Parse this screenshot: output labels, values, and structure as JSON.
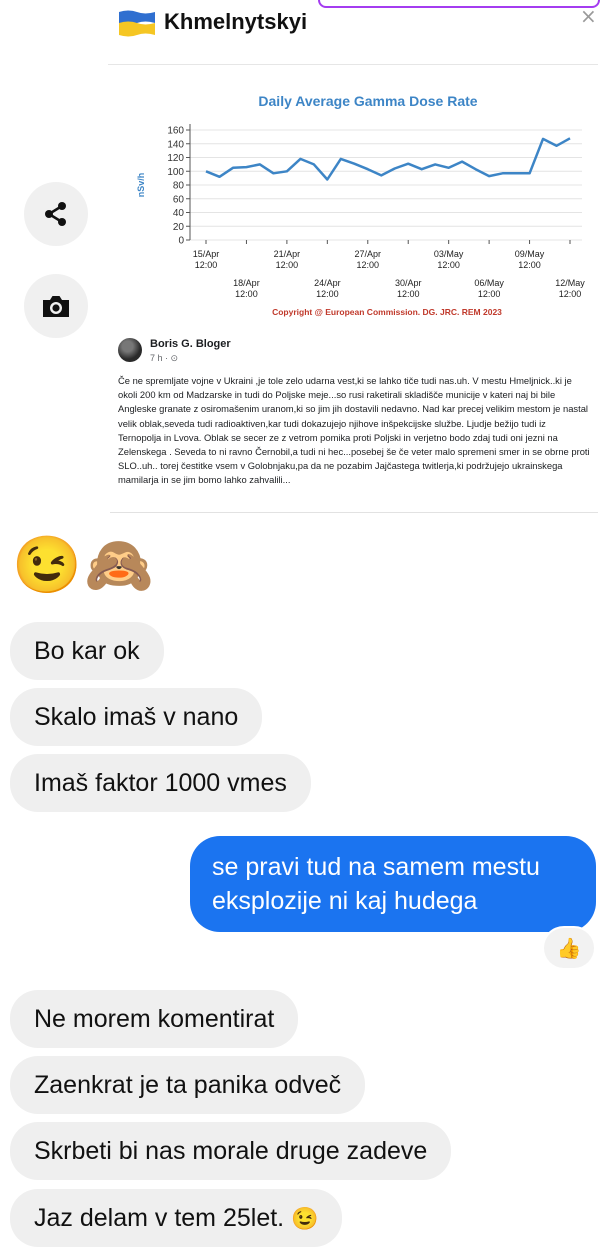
{
  "header": {
    "location": "Khmelnytskyi",
    "flag_colors": [
      "#2f6fd0",
      "#f5c623"
    ]
  },
  "actions": [
    {
      "name": "share-icon"
    },
    {
      "name": "camera-icon"
    }
  ],
  "chart_data": {
    "type": "line",
    "title": "Daily Average Gamma Dose Rate",
    "ylabel": "nSv/h",
    "ylim": [
      0,
      160
    ],
    "yticks": [
      0,
      20,
      40,
      60,
      80,
      100,
      120,
      140,
      160
    ],
    "xticks_top": [
      [
        "15/Apr",
        "12:00"
      ],
      [
        "21/Apr",
        "12:00"
      ],
      [
        "27/Apr",
        "12:00"
      ],
      [
        "03/May",
        "12:00"
      ],
      [
        "09/May",
        "12:00"
      ]
    ],
    "xticks_bottom": [
      [
        "18/Apr",
        "12:00"
      ],
      [
        "24/Apr",
        "12:00"
      ],
      [
        "30/Apr",
        "12:00"
      ],
      [
        "06/May",
        "12:00"
      ],
      [
        "12/May",
        "12:00"
      ]
    ],
    "x_start": "15/Apr",
    "x": [
      "15/Apr",
      "16/Apr",
      "17/Apr",
      "18/Apr",
      "19/Apr",
      "20/Apr",
      "21/Apr",
      "22/Apr",
      "23/Apr",
      "24/Apr",
      "25/Apr",
      "26/Apr",
      "27/Apr",
      "28/Apr",
      "29/Apr",
      "30/Apr",
      "01/May",
      "02/May",
      "03/May",
      "04/May",
      "05/May",
      "06/May",
      "07/May",
      "08/May",
      "09/May",
      "10/May",
      "11/May",
      "12/May"
    ],
    "values": [
      100,
      92,
      105,
      106,
      110,
      97,
      100,
      118,
      110,
      88,
      118,
      111,
      103,
      94,
      104,
      111,
      103,
      110,
      105,
      114,
      103,
      93,
      97,
      97,
      97,
      147,
      137,
      148
    ],
    "line_color": "#3d85c6",
    "copyright": "Copyright @ European Commission. DG. JRC. REM 2023"
  },
  "post": {
    "author": "Boris G. Bloger",
    "time": "7 h · ⊙",
    "text": "Če ne spremljate vojne v Ukraini ,je tole zelo udarna vest,ki se lahko tiče tudi nas.uh.  V mestu Hmeljnick..ki je okoli 200 km od Madzarske in tudi do Poljske meje...so rusi raketirali skladišče municije v kateri naj bi bile Angleske granate z osiromašenim uranom,ki so jim jih dostavili nedavno. Nad kar precej velikim mestom je nastal velik oblak,seveda tudi radioaktiven,kar tudi dokazujejo njihove inšpekcijske službe. Ljudje bežijo tudi iz Ternopolja in Lvova. Oblak se secer ze z vetrom pomika proti Poljski in verjetno bodo zdaj tudi oni jezni na Zelenskega . Seveda to ni ravno Černobil,a tudi ni hec...posebej še če veter malo spremeni smer in se obrne proti SLO..uh.. torej čestitke vsem v Golobnjaku,pa da ne pozabim Jajčastega twitlerja,ki podržujejo ukrainskega mamilarja in se jim bomo lahko zahvalili..."
  },
  "messages": {
    "emoji_1": "😉",
    "emoji_2": "🙈",
    "m1": "Bo kar ok",
    "m2": "Skalo imaš v nano",
    "m3": "Imaš faktor 1000 vmes",
    "sent": "se pravi tud na samem mestu eksplozije ni kaj hudega",
    "reaction": "👍",
    "m4": "Ne morem komentirat",
    "m5": "Zaenkrat je ta panika odveč",
    "m6": "Skrbeti bi nas morale druge zadeve",
    "m7": "Jaz delam v tem 25let.",
    "m7_emoji": "😉"
  }
}
